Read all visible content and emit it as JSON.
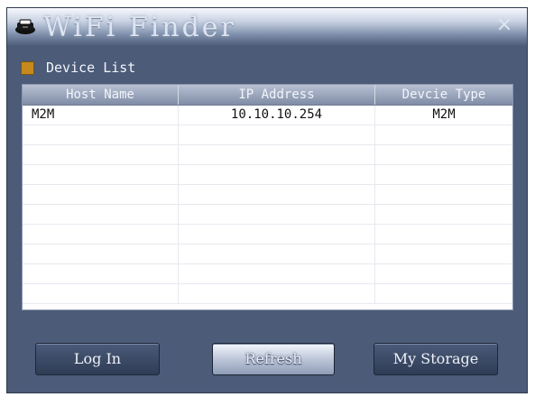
{
  "window": {
    "title": "WiFi Finder",
    "close_glyph": "×"
  },
  "device_list": {
    "label": "Device List",
    "columns": [
      "Host Name",
      "IP Address",
      "Devcie Type"
    ],
    "rows": [
      {
        "host": "M2M",
        "ip": "10.10.10.254",
        "type": "M2M"
      },
      {
        "host": "",
        "ip": "",
        "type": ""
      },
      {
        "host": "",
        "ip": "",
        "type": ""
      },
      {
        "host": "",
        "ip": "",
        "type": ""
      },
      {
        "host": "",
        "ip": "",
        "type": ""
      },
      {
        "host": "",
        "ip": "",
        "type": ""
      },
      {
        "host": "",
        "ip": "",
        "type": ""
      },
      {
        "host": "",
        "ip": "",
        "type": ""
      },
      {
        "host": "",
        "ip": "",
        "type": ""
      },
      {
        "host": "",
        "ip": "",
        "type": ""
      }
    ]
  },
  "buttons": {
    "login": "Log In",
    "refresh": "Refresh",
    "my_storage": "My Storage"
  },
  "icons": {
    "app": "router-icon",
    "section": "folder-icon",
    "close": "close-icon"
  },
  "colors": {
    "window_bg": "#4b5b78",
    "section_icon": "#c68a1c",
    "list_bg": "#ffffff"
  }
}
